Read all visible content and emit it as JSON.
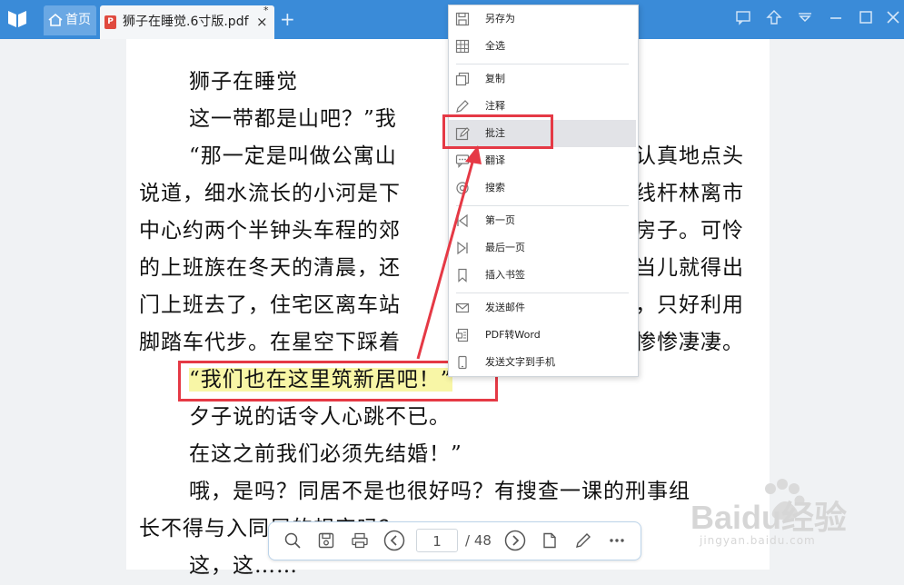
{
  "titlebar": {
    "home_tab_label": "首页",
    "doc_tab_label": "狮子在睡觉.6寸版.pdf",
    "doc_tab_close": "×",
    "doc_tab_modified": "*",
    "add_tab": "+"
  },
  "document": {
    "lines": [
      "狮子在睡觉",
      "这一带都是山吧？”我",
      "“那一定是叫做公寓山",
      "认真地点头",
      "说道，细水流长的小河是下",
      "线杆林离市",
      "中心约两个半钟头车程的郊",
      "房子。可怜",
      "的上班族在冬天的清晨，还",
      "当儿就得出",
      "门上班去了，住宅区离车站",
      "，只好利用",
      "脚踏车代步。在星空下踩着",
      "惨惨凄凄。",
      "“我们也在这里筑新居吧！”",
      "夕子说的话令人心跳不已。",
      "在这之前我们必须先结婚！”",
      "哦，是吗？同居不是也很好吗？有搜查一课的刑事组",
      "长不得与入同居的规定吗？",
      "这，这……"
    ]
  },
  "context_menu": {
    "items": [
      {
        "label": "另存为",
        "icon": "save-as-icon"
      },
      {
        "label": "全选",
        "icon": "select-all-icon"
      },
      {
        "label": "复制",
        "icon": "copy-icon"
      },
      {
        "label": "注释",
        "icon": "pencil-icon"
      },
      {
        "label": "批注",
        "icon": "annotate-icon"
      },
      {
        "label": "翻译",
        "icon": "translate-icon"
      },
      {
        "label": "搜索",
        "icon": "search-icon"
      },
      {
        "label": "第一页",
        "icon": "first-page-icon"
      },
      {
        "label": "最后一页",
        "icon": "last-page-icon"
      },
      {
        "label": "插入书签",
        "icon": "bookmark-icon"
      },
      {
        "label": "发送邮件",
        "icon": "mail-icon"
      },
      {
        "label": "PDF转Word",
        "icon": "pdf-to-word-icon"
      },
      {
        "label": "发送文字到手机",
        "icon": "phone-icon"
      }
    ],
    "active_item": "批注"
  },
  "bottom_toolbar": {
    "current_page": "1",
    "total_pages": "/ 48"
  },
  "watermark": {
    "brand": "Baidu经验",
    "url": "jingyan.baidu.com"
  },
  "colors": {
    "titlebar": "#3a8bd8",
    "highlight": "#f8f6a6",
    "annotation_red": "#e53945",
    "menu_active": "#e2e3e7"
  }
}
